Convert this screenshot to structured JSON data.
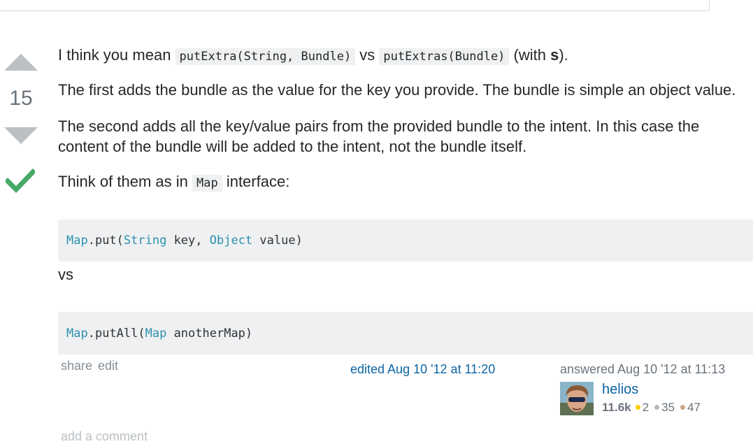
{
  "vote": {
    "count": "15"
  },
  "answer": {
    "p1_before": "I think you mean ",
    "p1_code1": "putExtra(String, Bundle)",
    "p1_mid": " vs ",
    "p1_code2": "putExtras(Bundle)",
    "p1_after1": " (with ",
    "p1_bold": "s",
    "p1_after2": ").",
    "p2": "The first adds the bundle as the value for the key you provide. The bundle is simple an object value.",
    "p3": "The second adds all the key/value pairs from the provided bundle to the intent. In this case the content of the bundle will be added to the intent, not the bundle itself.",
    "p4_before": "Think of them as in ",
    "p4_code": "Map",
    "p4_after": " interface:",
    "code1": {
      "t1": "Map",
      "t2": ".put(",
      "t3": "String",
      "t4": " key, ",
      "t5": "Object",
      "t6": " value)"
    },
    "vs": "vs",
    "code2": {
      "t1": "Map",
      "t2": ".putAll(",
      "t3": "Map",
      "t4": " anotherMap)"
    }
  },
  "menu": {
    "share": "share",
    "edit": "edit"
  },
  "edited": "edited Aug 10 '12 at 11:20",
  "answered": "answered Aug 10 '12 at 11:13",
  "user": {
    "name": "helios",
    "rep": "11.6k",
    "gold": "2",
    "silver": "35",
    "bronze": "47"
  },
  "comments": {
    "add_label": "add a comment"
  },
  "colors": {
    "accept": "#48a868",
    "link": "#0c65a5",
    "vote_arrow": "#bbc0c4"
  }
}
